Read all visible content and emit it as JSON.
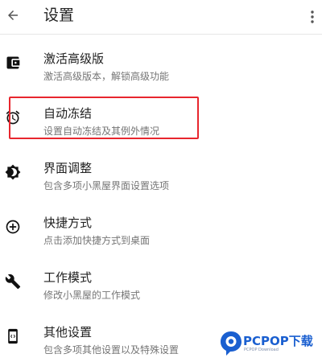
{
  "header": {
    "title": "设置",
    "back_icon": "arrow-back-icon",
    "more_icon": "more-vert-icon"
  },
  "settings": [
    {
      "icon": "wallet-icon",
      "label": "激活高级版",
      "description": "激活高级版本，解锁高级功能"
    },
    {
      "icon": "alarm-icon",
      "label": "自动冻结",
      "description": "设置自动冻结及其例外情况"
    },
    {
      "icon": "brightness-icon",
      "label": "界面调整",
      "description": "包含多项小黑屋界面设置选项"
    },
    {
      "icon": "add-circle-icon",
      "label": "快捷方式",
      "description": "点击添加快捷方式到桌面"
    },
    {
      "icon": "wrench-icon",
      "label": "工作模式",
      "description": "修改小黑屋的工作模式"
    },
    {
      "icon": "settings-code-icon",
      "label": "其他设置",
      "description": "包含多项其他设置以及特殊设置"
    }
  ],
  "annotation": {
    "highlight_color": "#e8262e"
  },
  "watermark": {
    "brand": "PCPOP下载",
    "sub": "PCPOP Download",
    "color": "#1a5fd0"
  }
}
